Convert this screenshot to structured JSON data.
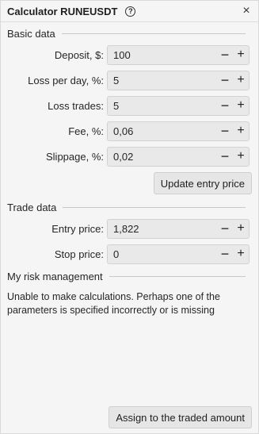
{
  "header": {
    "title": "Calculator RUNEUSDT",
    "help_glyph": "?",
    "close_glyph": "×"
  },
  "basic": {
    "title": "Basic data",
    "fields": [
      {
        "label": "Deposit, $:",
        "value": "100"
      },
      {
        "label": "Loss per day, %:",
        "value": "5"
      },
      {
        "label": "Loss trades:",
        "value": "5"
      },
      {
        "label": "Fee, %:",
        "value": "0,06"
      },
      {
        "label": "Slippage, %:",
        "value": "0,02"
      }
    ],
    "update_button": "Update entry price"
  },
  "trade": {
    "title": "Trade data",
    "fields": [
      {
        "label": "Entry price:",
        "value": "1,822"
      },
      {
        "label": "Stop price:",
        "value": "0"
      }
    ]
  },
  "risk": {
    "title": "My risk management",
    "message": "Unable to make calculations. Perhaps one of the parameters is specified incorrectly or is missing"
  },
  "assign_button": "Assign to the traded amount",
  "stepper": {
    "minus": "−",
    "plus": "+"
  }
}
